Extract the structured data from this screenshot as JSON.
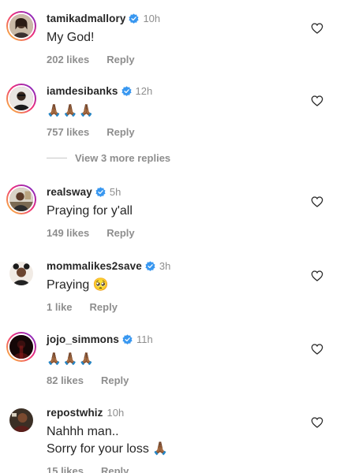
{
  "comments": [
    {
      "username": "tamikadmallory",
      "verified": true,
      "time": "10h",
      "text": "My God!",
      "likes": "202 likes",
      "reply": "Reply"
    },
    {
      "username": "iamdesibanks",
      "verified": true,
      "time": "12h",
      "text": "🙏🏾🙏🏾🙏🏾",
      "likes": "757 likes",
      "reply": "Reply"
    },
    {
      "username": "realsway",
      "verified": true,
      "time": "5h",
      "text": "Praying for y'all",
      "likes": "149 likes",
      "reply": "Reply"
    },
    {
      "username": "mommalikes2save",
      "verified": true,
      "time": "3h",
      "text": "Praying 🥺",
      "likes": "1 like",
      "reply": "Reply"
    },
    {
      "username": "jojo_simmons",
      "verified": true,
      "time": "11h",
      "text": "🙏🏾🙏🏾🙏🏾",
      "likes": "82 likes",
      "reply": "Reply"
    },
    {
      "username": "repostwhiz",
      "verified": false,
      "time": "10h",
      "text": "Nahhh man..\nSorry for your loss 🙏🏾",
      "likes": "15 likes",
      "reply": "Reply"
    }
  ],
  "view_more_replies": "View 3 more replies",
  "colors": {
    "text": "#262626",
    "secondary": "#8e8e8e",
    "verified": "#3897f0"
  },
  "icons": {
    "verified": "verified-badge-icon",
    "like": "heart-outline-icon",
    "avatar": "profile-photo"
  }
}
